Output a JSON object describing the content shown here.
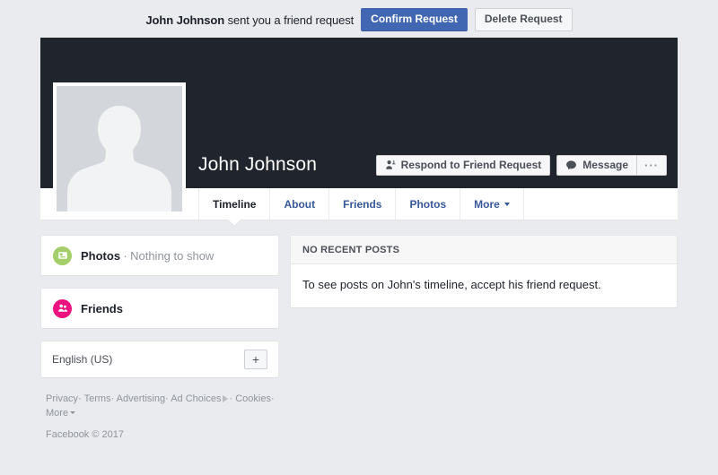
{
  "request_bar": {
    "who": "John Johnson",
    "message": " sent you a friend request",
    "confirm_label": "Confirm Request",
    "delete_label": "Delete Request"
  },
  "profile": {
    "name": "John Johnson",
    "avatar_icon": "user-silhouette-icon",
    "actions": {
      "respond_label": "Respond to Friend Request",
      "respond_icon": "friend-request-icon",
      "message_label": "Message",
      "message_icon": "message-bubble-icon",
      "more_label": "···",
      "more_icon": "ellipsis-icon"
    }
  },
  "tabs": [
    {
      "label": "Timeline",
      "active": true
    },
    {
      "label": "About",
      "active": false
    },
    {
      "label": "Friends",
      "active": false
    },
    {
      "label": "Photos",
      "active": false
    },
    {
      "label": "More",
      "active": false,
      "caret": true
    }
  ],
  "sidebar": {
    "photos": {
      "label": "Photos",
      "separator": "·",
      "status": "Nothing to show",
      "icon": "photos-icon",
      "icon_color": "#A4CE6A"
    },
    "friends": {
      "label": "Friends",
      "icon": "friends-icon",
      "icon_color": "#EC1280"
    },
    "language": {
      "current": "English (US)",
      "add_label": "+",
      "add_icon": "plus-icon"
    }
  },
  "footer": {
    "links": [
      "Privacy",
      "Terms",
      "Advertising",
      "Ad Choices",
      "Cookies",
      "More"
    ],
    "separator": "·",
    "copyright": "Facebook © 2017"
  },
  "main": {
    "posts_header": "NO RECENT POSTS",
    "posts_body": "To see posts on John's timeline, accept his friend request."
  },
  "colors": {
    "brand_blue": "#4267B2",
    "link_blue": "#365899",
    "cover_dark": "#1F242D",
    "page_bg": "#E9EBEE"
  }
}
